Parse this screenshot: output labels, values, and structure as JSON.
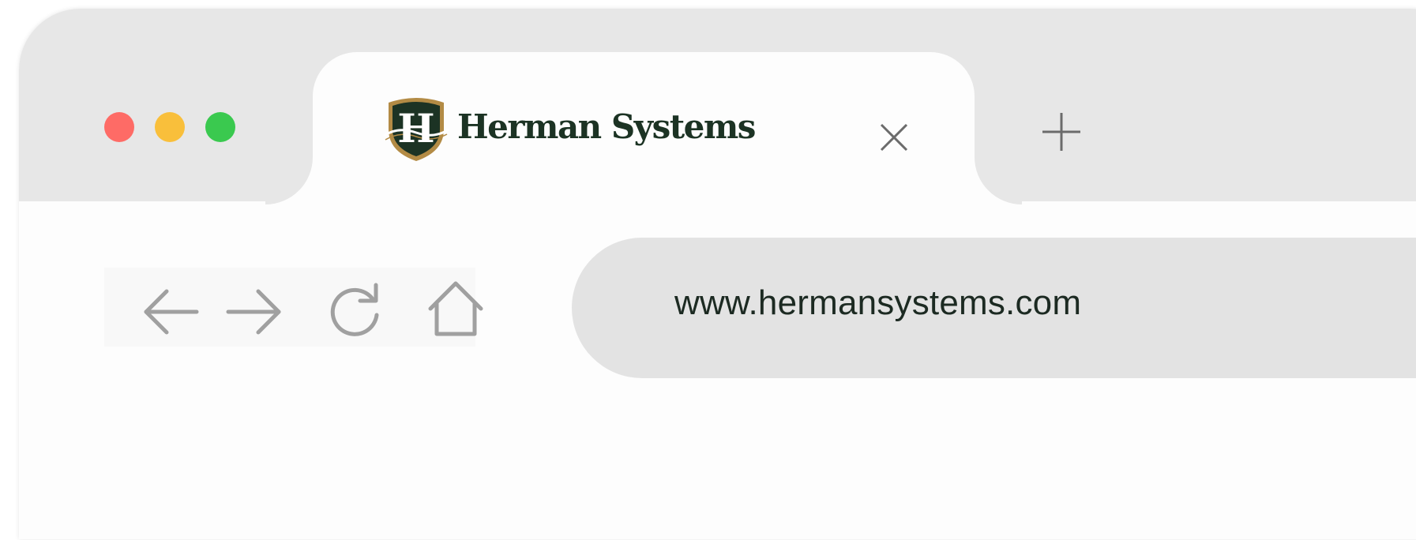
{
  "window": {
    "traffic_lights": [
      {
        "name": "close",
        "color": "#fe6b66"
      },
      {
        "name": "minimize",
        "color": "#f9bf3b"
      },
      {
        "name": "maximize",
        "color": "#3ac94f"
      }
    ]
  },
  "tab": {
    "title": "Herman Systems",
    "logo_letter": "H",
    "logo_colors": {
      "shield": "#1c3324",
      "border": "#b38b45",
      "letter": "#ffffff"
    },
    "close_icon": "close-icon"
  },
  "new_tab": {
    "icon": "plus-icon"
  },
  "toolbar": {
    "icons": [
      "back-arrow-icon",
      "forward-arrow-icon",
      "reload-icon",
      "home-icon"
    ],
    "icon_color": "#a0a0a0"
  },
  "address_bar": {
    "url": "www.hermansystems.com"
  }
}
